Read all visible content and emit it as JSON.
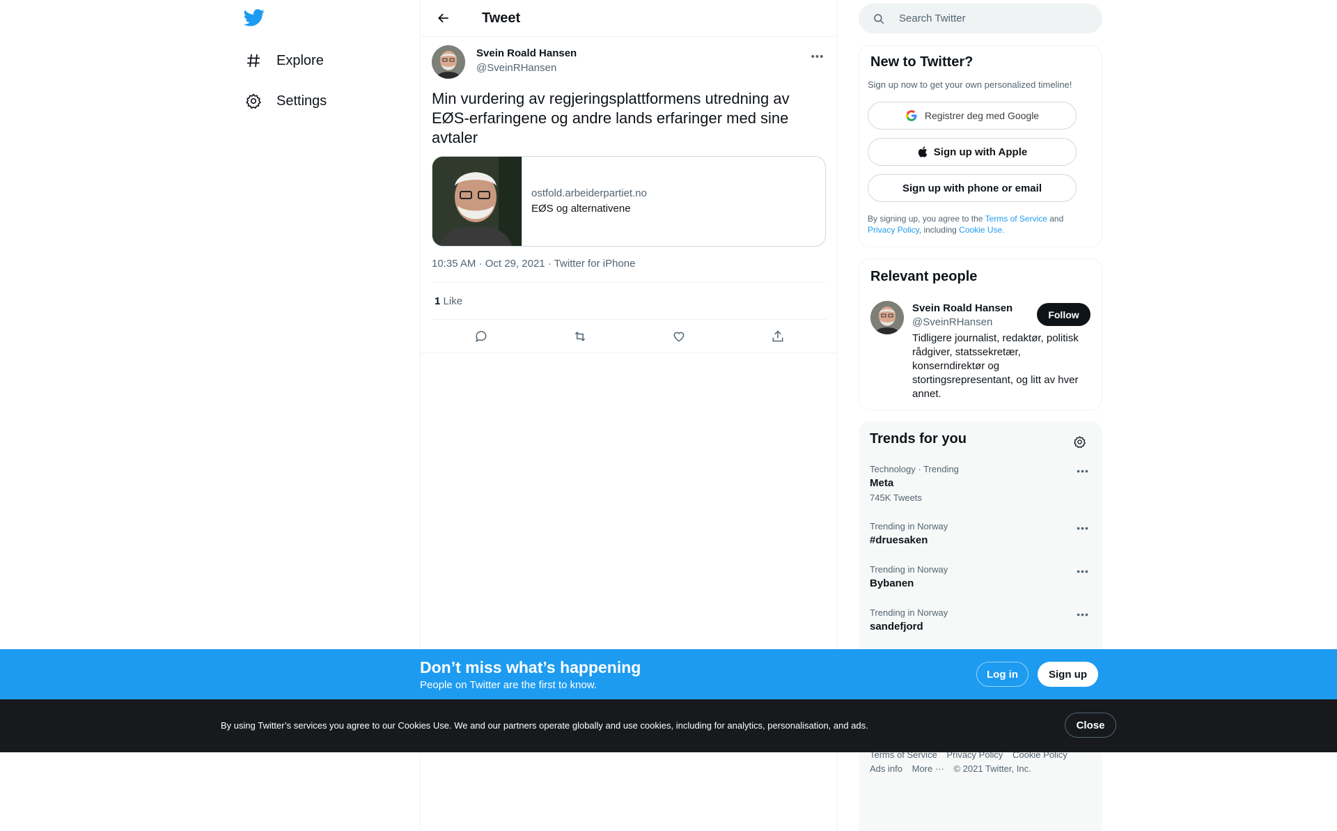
{
  "nav": {
    "logo": "twitter-bird-icon",
    "explore_label": "Explore",
    "settings_label": "Settings"
  },
  "header": {
    "title": "Tweet"
  },
  "tweet": {
    "author_name": "Svein Roald Hansen",
    "author_handle": "@SveinRHansen",
    "text": "Min vurdering av regjeringsplattformens utredning av EØS-erfaringene og andre lands erfaringer med sine avtaler",
    "card_domain": "ostfold.arbeiderpartiet.no",
    "card_title": "EØS og alternativene",
    "time": "10:35 AM",
    "date": "Oct 29, 2021",
    "source": "Twitter for iPhone",
    "like_count": "1",
    "like_label": "Like"
  },
  "search": {
    "placeholder": "Search Twitter"
  },
  "signup": {
    "title": "New to Twitter?",
    "subtitle": "Sign up now to get your own personalized timeline!",
    "google_label": "Registrer deg med Google",
    "apple_label": "Sign up with Apple",
    "phone_label": "Sign up with phone or email",
    "terms_prefix": "By signing up, you agree to the ",
    "terms_link": "Terms of Service",
    "terms_and": " and ",
    "privacy_link": "Privacy Policy",
    "terms_including": ", including ",
    "cookie_link": "Cookie Use."
  },
  "people": {
    "title": "Relevant people",
    "name": "Svein Roald Hansen",
    "handle": "@SveinRHansen",
    "follow_label": "Follow",
    "bio": "Tidligere journalist, redaktør, politisk rådgiver, statssekretær, konserndirektør og stortingsrepresentant, og litt av hver annet."
  },
  "trends": {
    "title": "Trends for you",
    "items": [
      {
        "context": "Technology · Trending",
        "name": "Meta",
        "count": "745K Tweets"
      },
      {
        "context": "Trending in Norway",
        "name": "#druesaken",
        "count": ""
      },
      {
        "context": "Trending in Norway",
        "name": "Bybanen",
        "count": ""
      },
      {
        "context": "Trending in Norway",
        "name": "sandefjord",
        "count": ""
      }
    ]
  },
  "footer": {
    "terms": "Terms of Service",
    "privacy": "Privacy Policy",
    "cookie": "Cookie Policy",
    "ads": "Ads info",
    "more": "More ···",
    "copyright": "© 2021 Twitter, Inc."
  },
  "banner": {
    "title": "Don’t miss what’s happening",
    "subtitle": "People on Twitter are the first to know.",
    "login_label": "Log in",
    "signup_label": "Sign up"
  },
  "cookie_bar": {
    "text": "By using Twitter’s services you agree to our Cookies Use. We and our partners operate globally and use cookies, including for analytics, personalisation, and ads.",
    "close_label": "Close"
  },
  "colors": {
    "accent": "#1d9bf0",
    "text": "#0f1419",
    "secondary": "#536471",
    "cookie_bg": "#17191c"
  }
}
